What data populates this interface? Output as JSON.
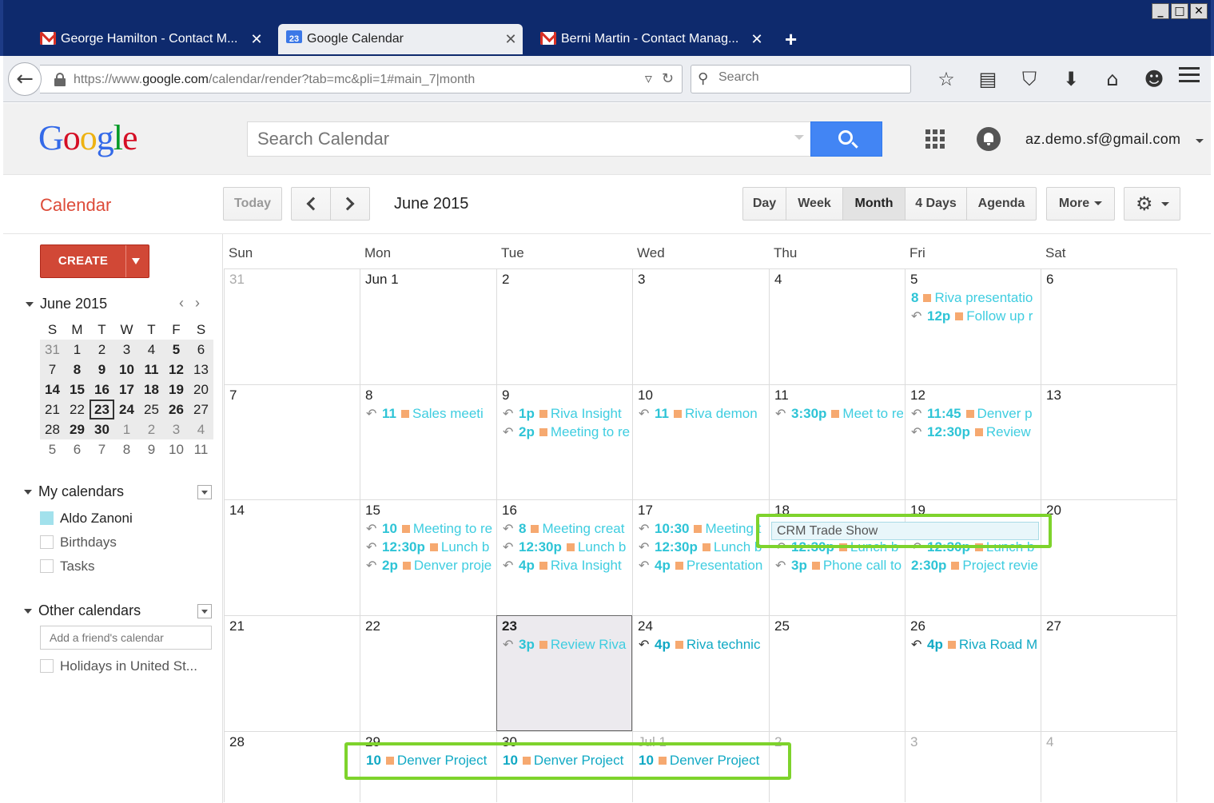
{
  "browser": {
    "tabs": [
      {
        "label": "George Hamilton - Contact M...",
        "icon": "gmail-icon"
      },
      {
        "label": "Google Calendar",
        "icon": "calendar-icon",
        "badge": "23"
      },
      {
        "label": "Berni Martin - Contact Manag...",
        "icon": "gmail-icon"
      }
    ],
    "close_glyph": "✕",
    "new_tab_glyph": "+",
    "url_prefix": "https://www.",
    "url_host": "google.com",
    "url_path": "/calendar/render?tab=mc&pli=1#main_7|month",
    "search_placeholder": "Search",
    "window_buttons": [
      "_",
      "□",
      "✕"
    ]
  },
  "header": {
    "logo_letters": [
      "G",
      "o",
      "o",
      "g",
      "l",
      "e"
    ],
    "search_placeholder": "Search Calendar",
    "account": "az.demo.sf@gmail.com"
  },
  "toolbar": {
    "title": "Calendar",
    "today": "Today",
    "current_month": "June 2015",
    "views": [
      "Day",
      "Week",
      "Month",
      "4 Days",
      "Agenda"
    ],
    "selected_view": "Month",
    "more": "More"
  },
  "sidebar": {
    "create": "CREATE",
    "mini_month": "June 2015",
    "mini_nav": "‹›",
    "mini_dow": [
      "S",
      "M",
      "T",
      "W",
      "T",
      "F",
      "S"
    ],
    "my_calendars": "My calendars",
    "my_calendar_items": [
      {
        "label": "Aldo Zanoni",
        "checked": true
      },
      {
        "label": "Birthdays",
        "checked": false
      },
      {
        "label": "Tasks",
        "checked": false
      }
    ],
    "other_calendars": "Other calendars",
    "add_friend_placeholder": "Add a friend's calendar",
    "other_calendar_items": [
      {
        "label": "Holidays in United St...",
        "checked": false
      }
    ]
  },
  "grid": {
    "dow": [
      "Sun",
      "Mon",
      "Tue",
      "Wed",
      "Thu",
      "Fri",
      "Sat"
    ],
    "weeks": [
      [
        "31",
        "Jun 1",
        "2",
        "3",
        "4",
        "5",
        "6"
      ],
      [
        "7",
        "8",
        "9",
        "10",
        "11",
        "12",
        "13"
      ],
      [
        "14",
        "15",
        "16",
        "17",
        "18",
        "19",
        "20"
      ],
      [
        "21",
        "22",
        "23",
        "24",
        "25",
        "26",
        "27"
      ],
      [
        "28",
        "29",
        "30",
        "Jul 1",
        "2",
        "3",
        "4"
      ]
    ],
    "all_day_event": "CRM Trade Show",
    "events": {
      "w0d5": [
        {
          "time": "8",
          "title": "Riva presentatio",
          "reply": false
        },
        {
          "time": "12p",
          "title": "Follow up r",
          "reply": true
        }
      ],
      "w1d1": [
        {
          "time": "11",
          "title": "Sales meeti",
          "reply": true
        }
      ],
      "w1d2": [
        {
          "time": "1p",
          "title": "Riva Insight",
          "reply": true
        },
        {
          "time": "2p",
          "title": "Meeting to re",
          "reply": true
        }
      ],
      "w1d3": [
        {
          "time": "11",
          "title": "Riva demon",
          "reply": true
        }
      ],
      "w1d4": [
        {
          "time": "3:30p",
          "title": "Meet to re",
          "reply": true
        }
      ],
      "w1d5": [
        {
          "time": "11:45",
          "title": "Denver p",
          "reply": true
        },
        {
          "time": "12:30p",
          "title": "Review",
          "reply": true
        }
      ],
      "w2d1": [
        {
          "time": "10",
          "title": "Meeting to re",
          "reply": true
        },
        {
          "time": "12:30p",
          "title": "Lunch b",
          "reply": true
        },
        {
          "time": "2p",
          "title": "Denver proje",
          "reply": true
        }
      ],
      "w2d2": [
        {
          "time": "8",
          "title": "Meeting creat",
          "reply": true
        },
        {
          "time": "12:30p",
          "title": "Lunch b",
          "reply": true
        },
        {
          "time": "4p",
          "title": "Riva Insight",
          "reply": true
        }
      ],
      "w2d3": [
        {
          "time": "10:30",
          "title": "Meeting t",
          "reply": true
        },
        {
          "time": "12:30p",
          "title": "Lunch b",
          "reply": true
        },
        {
          "time": "4p",
          "title": "Presentation",
          "reply": true
        }
      ],
      "w2d4": [
        {
          "time": "12:30p",
          "title": "Lunch b",
          "reply": true
        },
        {
          "time": "3p",
          "title": "Phone call to",
          "reply": true
        }
      ],
      "w2d5": [
        {
          "time": "12:30p",
          "title": "Lunch b",
          "reply": true
        },
        {
          "time": "2:30p",
          "title": "Project revie",
          "reply": false
        }
      ],
      "w3d2": [
        {
          "time": "3p",
          "title": "Review Riva",
          "reply": true
        }
      ],
      "w3d3": [
        {
          "time": "4p",
          "title": "Riva technic",
          "reply": true,
          "dark": true
        }
      ],
      "w3d5": [
        {
          "time": "4p",
          "title": "Riva Road M",
          "reply": true,
          "dark": true
        }
      ],
      "w4d1": [
        {
          "time": "10",
          "title": "Denver Project",
          "reply": false,
          "dark": true
        }
      ],
      "w4d2": [
        {
          "time": "10",
          "title": "Denver Project",
          "reply": false,
          "dark": true
        }
      ],
      "w4d3": [
        {
          "time": "10",
          "title": "Denver Project",
          "reply": false,
          "dark": true
        }
      ]
    }
  },
  "colors": {
    "accent": "#dd4b39",
    "event_text": "#3fcde0",
    "event_square": "#f6a970",
    "highlight": "#7ed32c",
    "search_button": "#4285f4"
  }
}
